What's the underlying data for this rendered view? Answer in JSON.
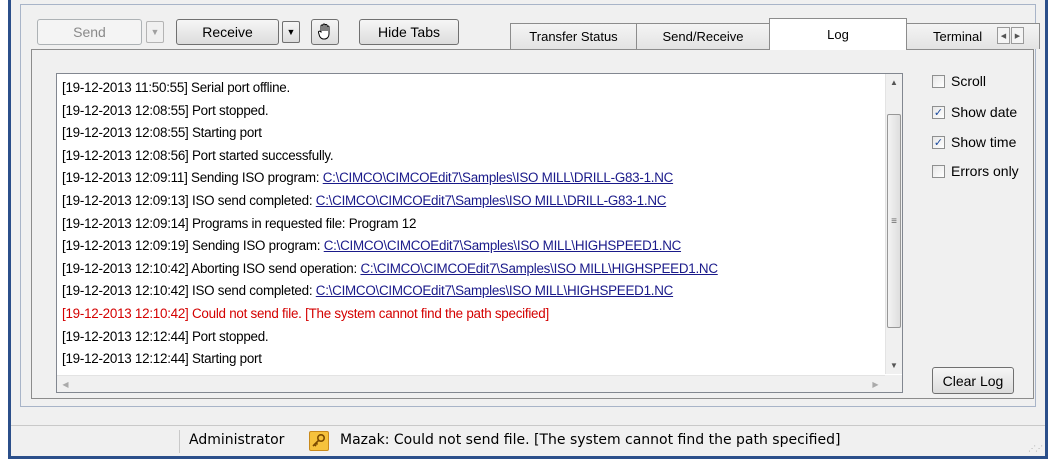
{
  "toolbar": {
    "send_label": "Send",
    "receive_label": "Receive",
    "hide_tabs_label": "Hide Tabs"
  },
  "tabs": [
    {
      "label": "Transfer Status",
      "active": false
    },
    {
      "label": "Send/Receive",
      "active": false
    },
    {
      "label": "Log",
      "active": true
    },
    {
      "label": "Terminal",
      "active": false
    }
  ],
  "log": [
    {
      "prefix": "[19-12-2013 11:50:55] Serial port offline.",
      "link": "",
      "error": false
    },
    {
      "prefix": "[19-12-2013 12:08:55] Port stopped.",
      "link": "",
      "error": false
    },
    {
      "prefix": "[19-12-2013 12:08:55] Starting port",
      "link": "",
      "error": false
    },
    {
      "prefix": "[19-12-2013 12:08:56] Port started successfully.",
      "link": "",
      "error": false
    },
    {
      "prefix": "[19-12-2013 12:09:11] Sending ISO program: ",
      "link": "C:\\CIMCO\\CIMCOEdit7\\Samples\\ISO MILL\\DRILL-G83-1.NC",
      "error": false
    },
    {
      "prefix": "[19-12-2013 12:09:13] ISO send completed: ",
      "link": "C:\\CIMCO\\CIMCOEdit7\\Samples\\ISO MILL\\DRILL-G83-1.NC",
      "error": false
    },
    {
      "prefix": "[19-12-2013 12:09:14] Programs in requested file: Program 12",
      "link": "",
      "error": false
    },
    {
      "prefix": "[19-12-2013 12:09:19] Sending ISO program: ",
      "link": "C:\\CIMCO\\CIMCOEdit7\\Samples\\ISO MILL\\HIGHSPEED1.NC",
      "error": false
    },
    {
      "prefix": "[19-12-2013 12:10:42] Aborting ISO send operation: ",
      "link": "C:\\CIMCO\\CIMCOEdit7\\Samples\\ISO MILL\\HIGHSPEED1.NC",
      "error": false
    },
    {
      "prefix": "[19-12-2013 12:10:42] ISO send completed: ",
      "link": "C:\\CIMCO\\CIMCOEdit7\\Samples\\ISO MILL\\HIGHSPEED1.NC",
      "error": false
    },
    {
      "prefix": "[19-12-2013 12:10:42] Could not send file. [The system cannot find the path specified]",
      "link": "",
      "error": true
    },
    {
      "prefix": "[19-12-2013 12:12:44] Port stopped.",
      "link": "",
      "error": false
    },
    {
      "prefix": "[19-12-2013 12:12:44] Starting port",
      "link": "",
      "error": false
    }
  ],
  "options": [
    {
      "label": "Scroll",
      "checked": false
    },
    {
      "label": "Show date",
      "checked": true
    },
    {
      "label": "Show time",
      "checked": true
    },
    {
      "label": "Errors only",
      "checked": false
    }
  ],
  "clear_log_label": "Clear Log",
  "status": {
    "user": "Administrator",
    "message": "Mazak: Could not send file. [The system cannot find the path specified]"
  },
  "colors": {
    "error_text": "#d40000",
    "link_text": "#1a1a8a",
    "window_border": "#2b4f8a"
  }
}
